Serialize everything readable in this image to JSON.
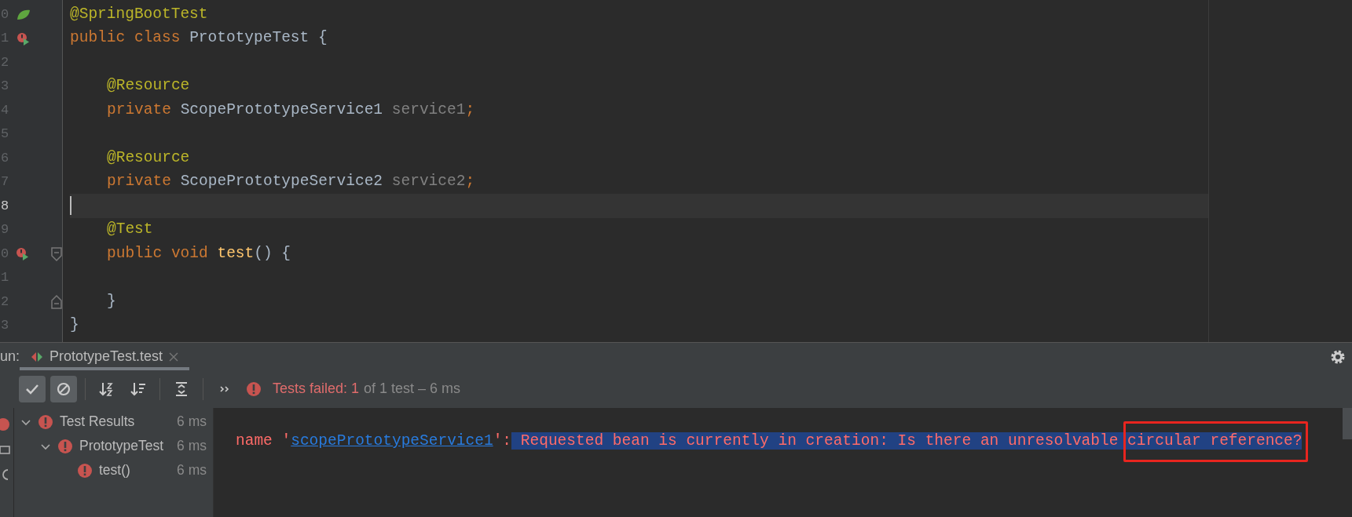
{
  "editor": {
    "lines": [
      {
        "number": "0",
        "gutter": {
          "kind": "leaf"
        },
        "current": false,
        "indented": false,
        "tokens": [
          {
            "kind": "annotation",
            "text": "@SpringBootTest"
          }
        ]
      },
      {
        "number": "1",
        "gutter": {
          "kind": "run-error"
        },
        "current": false,
        "indented": false,
        "tokens": [
          {
            "kind": "keyword",
            "text": "public class "
          },
          {
            "kind": "plain",
            "text": "PrototypeTest {"
          }
        ]
      },
      {
        "number": "2",
        "current": false
      },
      {
        "number": "3",
        "current": false,
        "indented": true,
        "tokens": [
          {
            "kind": "annotation",
            "text": "@Resource"
          }
        ]
      },
      {
        "number": "4",
        "current": false,
        "indented": true,
        "tokens": [
          {
            "kind": "keyword",
            "text": "private "
          },
          {
            "kind": "plain",
            "text": "ScopePrototypeService1 "
          },
          {
            "kind": "unused",
            "text": "service1"
          },
          {
            "kind": "keyword",
            "text": ";"
          }
        ]
      },
      {
        "number": "5",
        "current": false
      },
      {
        "number": "6",
        "current": false,
        "indented": true,
        "tokens": [
          {
            "kind": "annotation",
            "text": "@Resource"
          }
        ]
      },
      {
        "number": "7",
        "current": false,
        "indented": true,
        "tokens": [
          {
            "kind": "keyword",
            "text": "private "
          },
          {
            "kind": "plain",
            "text": "ScopePrototypeService2 "
          },
          {
            "kind": "unused",
            "text": "service2"
          },
          {
            "kind": "keyword",
            "text": ";"
          }
        ]
      },
      {
        "number": "8",
        "current": true
      },
      {
        "number": "9",
        "current": false,
        "indented": true,
        "tokens": [
          {
            "kind": "annotation",
            "text": "@Test"
          }
        ]
      },
      {
        "number": "0",
        "gutter": {
          "kind": "run-error"
        },
        "fold": {
          "kind": "start"
        },
        "current": false,
        "indented": true,
        "tokens": [
          {
            "kind": "keyword",
            "text": "public void "
          },
          {
            "kind": "method",
            "text": "test"
          },
          {
            "kind": "plain",
            "text": "() {"
          }
        ]
      },
      {
        "number": "1",
        "current": false
      },
      {
        "number": "2",
        "fold": {
          "kind": "end"
        },
        "current": false,
        "indented": true,
        "tokens": [
          {
            "kind": "plain",
            "text": "}"
          }
        ]
      },
      {
        "number": "3",
        "current": false,
        "indented": false,
        "tokens": [
          {
            "kind": "plain",
            "text": "}"
          }
        ]
      }
    ]
  },
  "run": {
    "label": "un:",
    "tab": {
      "title": "PrototypeTest.test",
      "selected": true
    },
    "toolbar": [
      {
        "kind": "check",
        "on": true
      },
      {
        "kind": "ignored",
        "on": true
      },
      {
        "kind": "sort-alpha",
        "on": false
      },
      {
        "kind": "sort-duration",
        "on": false
      },
      {
        "kind": "expand",
        "on": false
      },
      {
        "kind": "more",
        "on": false
      }
    ],
    "status": {
      "failed": "Tests failed: 1",
      "summary": "of 1 test – 6 ms"
    },
    "tree": [
      {
        "label": "Test Results",
        "time": "6 ms",
        "expanded": true,
        "selected": false,
        "children": [
          {
            "label": "PrototypeTest",
            "time": "6 ms",
            "expanded": true,
            "selected": false,
            "children": [
              {
                "label": "test()",
                "time": "6 ms",
                "selected": false
              }
            ]
          }
        ]
      }
    ],
    "output": {
      "prefix": "name '",
      "link": "scopePrototypeService1",
      "middle": "':",
      "selected_text": "Requested bean is currently in creation: Is there an unresolvable ",
      "boxed_text": "circular reference?"
    }
  }
}
